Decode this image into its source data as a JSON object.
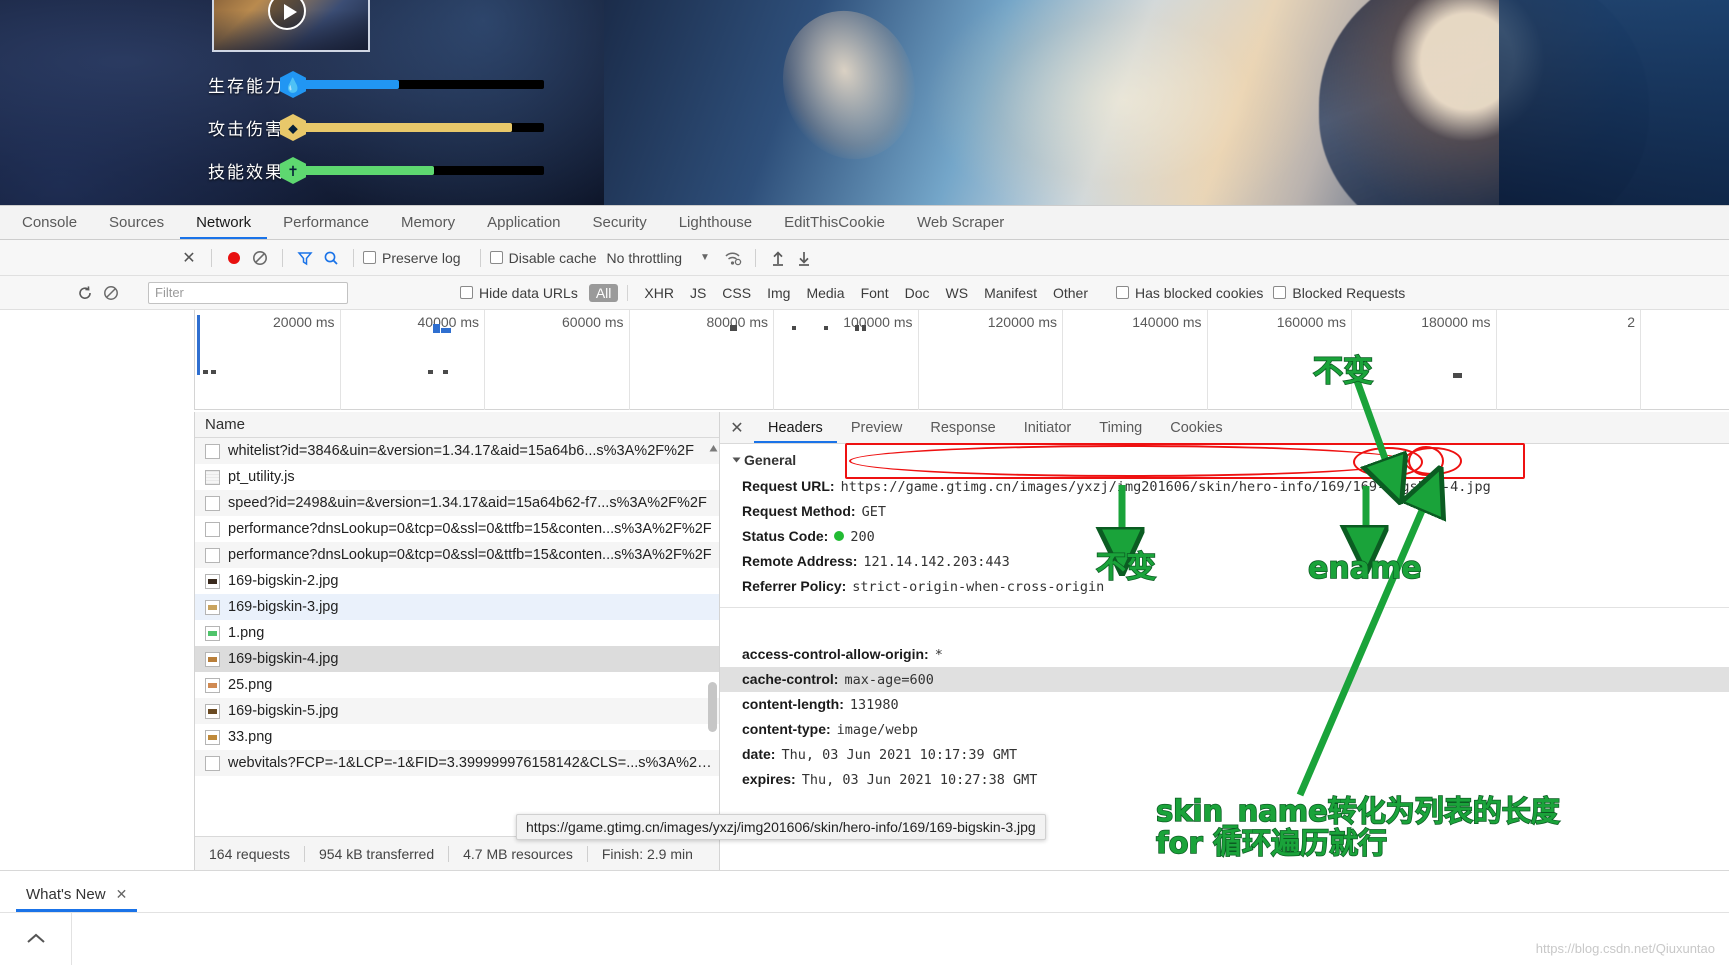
{
  "game": {
    "stats": [
      {
        "label": "生存能力",
        "icon": "water-drop-icon",
        "color": "#2196f3",
        "percent": 42
      },
      {
        "label": "攻击伤害",
        "icon": "shield-icon",
        "color": "#e8c86a",
        "percent": 87
      },
      {
        "label": "技能效果",
        "icon": "skill-icon",
        "color": "#5ed870",
        "percent": 56
      }
    ],
    "play_button": "play-icon"
  },
  "devtools": {
    "tabs": [
      {
        "label": "Console",
        "active": false
      },
      {
        "label": "Sources",
        "active": false
      },
      {
        "label": "Network",
        "active": true
      },
      {
        "label": "Performance",
        "active": false
      },
      {
        "label": "Memory",
        "active": false
      },
      {
        "label": "Application",
        "active": false
      },
      {
        "label": "Security",
        "active": false
      },
      {
        "label": "Lighthouse",
        "active": false
      },
      {
        "label": "EditThisCookie",
        "active": false
      },
      {
        "label": "Web Scraper",
        "active": false
      }
    ],
    "toolbar": {
      "close_label": "✕",
      "record_label": "record-icon",
      "clear_label": "clear-icon",
      "filter_label": "filter-icon",
      "search_label": "search-icon",
      "preserve_log": "Preserve log",
      "disable_cache": "Disable cache",
      "throttling": "No throttling",
      "import_label": "import-har-icon",
      "export_label": "export-har-icon"
    },
    "filterbar": {
      "reload_icon": "reload-icon",
      "clear_icon": "clear-icon",
      "filter_placeholder": "Filter",
      "hide_data_urls": "Hide data URLs",
      "types": [
        "All",
        "XHR",
        "JS",
        "CSS",
        "Img",
        "Media",
        "Font",
        "Doc",
        "WS",
        "Manifest",
        "Other"
      ],
      "active_type": "All",
      "has_blocked_cookies": "Has blocked cookies",
      "blocked_requests": "Blocked Requests"
    },
    "overview": {
      "ticks": [
        "20000 ms",
        "40000 ms",
        "60000 ms",
        "80000 ms",
        "100000 ms",
        "120000 ms",
        "140000 ms",
        "160000 ms",
        "180000 ms",
        "2"
      ]
    },
    "requests": {
      "column_header": "Name",
      "rows": [
        {
          "name": "whitelist?id=3846&uin=&version=1.34.17&aid=15a64b6...s%3A%2F%2F",
          "type": "doc",
          "state": "alt"
        },
        {
          "name": "pt_utility.js",
          "type": "js",
          "state": ""
        },
        {
          "name": "speed?id=2498&uin=&version=1.34.17&aid=15a64b62-f7...s%3A%2F%2F",
          "type": "doc",
          "state": "alt"
        },
        {
          "name": "performance?dnsLookup=0&tcp=0&ssl=0&ttfb=15&conten...s%3A%2F%2F",
          "type": "doc",
          "state": ""
        },
        {
          "name": "performance?dnsLookup=0&tcp=0&ssl=0&ttfb=15&conten...s%3A%2F%2F",
          "type": "doc",
          "state": "alt"
        },
        {
          "name": "169-bigskin-2.jpg",
          "type": "img",
          "state": ""
        },
        {
          "name": "169-bigskin-3.jpg",
          "type": "img",
          "state": "hl"
        },
        {
          "name": "1.png",
          "type": "img",
          "state": ""
        },
        {
          "name": "169-bigskin-4.jpg",
          "type": "img",
          "state": "sel"
        },
        {
          "name": "25.png",
          "type": "img",
          "state": ""
        },
        {
          "name": "169-bigskin-5.jpg",
          "type": "img",
          "state": "alt"
        },
        {
          "name": "33.png",
          "type": "img",
          "state": ""
        },
        {
          "name": "webvitals?FCP=-1&LCP=-1&FID=3.399999976158142&CLS=...s%3A%2F%2F",
          "type": "doc",
          "state": "alt"
        }
      ],
      "tooltip": "https://game.gtimg.cn/images/yxzj/img201606/skin/hero-info/169/169-bigskin-3.jpg"
    },
    "statusbar": {
      "requests": "164 requests",
      "transferred": "954 kB transferred",
      "resources": "4.7 MB resources",
      "finish": "Finish: 2.9 min"
    },
    "detail": {
      "close": "✕",
      "tabs": [
        {
          "label": "Headers",
          "active": true
        },
        {
          "label": "Preview",
          "active": false
        },
        {
          "label": "Response",
          "active": false
        },
        {
          "label": "Initiator",
          "active": false
        },
        {
          "label": "Timing",
          "active": false
        },
        {
          "label": "Cookies",
          "active": false
        }
      ],
      "general_title": "General",
      "general": [
        {
          "key": "Request URL:",
          "value": "https://game.gtimg.cn/images/yxzj/img201606/skin/hero-info/169/169-bigskin-4.jpg"
        },
        {
          "key": "Request Method:",
          "value": "GET"
        },
        {
          "key": "Status Code:",
          "value": "200",
          "status_dot": true
        },
        {
          "key": "Remote Address:",
          "value": "121.14.142.203:443"
        },
        {
          "key": "Referrer Policy:",
          "value": "strict-origin-when-cross-origin"
        }
      ],
      "response_headers": [
        {
          "key": "access-control-allow-origin:",
          "value": "*",
          "shade": false
        },
        {
          "key": "cache-control:",
          "value": "max-age=600",
          "shade": true
        },
        {
          "key": "content-length:",
          "value": "131980",
          "shade": false
        },
        {
          "key": "content-type:",
          "value": "image/webp",
          "shade": false
        },
        {
          "key": "date:",
          "value": "Thu, 03 Jun 2021 10:17:39 GMT",
          "shade": false
        },
        {
          "key": "expires:",
          "value": "Thu, 03 Jun 2021 10:27:38 GMT",
          "shade": false
        }
      ]
    }
  },
  "annotations": [
    {
      "id": "anno-top-right",
      "text": "不变"
    },
    {
      "id": "anno-left",
      "text": "不变"
    },
    {
      "id": "anno-ename",
      "text": "ename"
    },
    {
      "id": "anno-skinname",
      "text": "skin_name转化为列表的长度\nfor 循环遍历就行"
    }
  ],
  "bottom": {
    "whats_new": "What's New",
    "whats_new_close": "✕",
    "chevron": "chevron-up-icon",
    "watermark": "https://blog.csdn.net/Qiuxuntao"
  }
}
